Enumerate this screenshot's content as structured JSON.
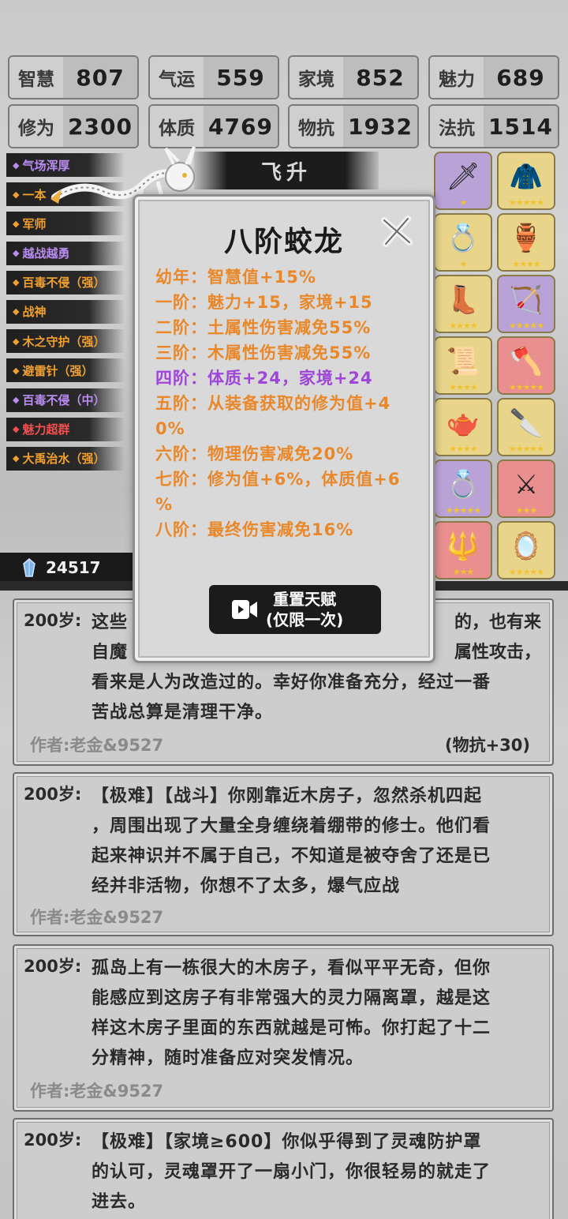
{
  "stats": [
    {
      "label": "智慧",
      "value": "807"
    },
    {
      "label": "气运",
      "value": "559"
    },
    {
      "label": "家境",
      "value": "852"
    },
    {
      "label": "魅力",
      "value": "689"
    },
    {
      "label": "修为",
      "value": "2300"
    },
    {
      "label": "体质",
      "value": "4769"
    },
    {
      "label": "物抗",
      "value": "1932"
    },
    {
      "label": "法抗",
      "value": "1514"
    }
  ],
  "talents": [
    {
      "label": "气场浑厚",
      "color": "#b98cf0"
    },
    {
      "label": "一本",
      "color": "#f0a030"
    },
    {
      "label": "军师",
      "color": "#f0a030"
    },
    {
      "label": "越战越勇",
      "color": "#b98cf0"
    },
    {
      "label": "百毒不侵（强）",
      "color": "#f0a030"
    },
    {
      "label": "战神",
      "color": "#f0a030"
    },
    {
      "label": "木之守护（强）",
      "color": "#f0a030"
    },
    {
      "label": "避雷针（强）",
      "color": "#f0a030"
    },
    {
      "label": "百毒不侵（中）",
      "color": "#b98cf0"
    },
    {
      "label": "魅力超群",
      "color": "#f05050"
    },
    {
      "label": "大禹治水（强）",
      "color": "#f0a030"
    }
  ],
  "banner": "飞升",
  "wealth": "24517",
  "equipment": [
    {
      "icon": "sword-icon",
      "glyph": "🗡",
      "bg": "#b9a3d6",
      "stars": "★"
    },
    {
      "icon": "armor-icon",
      "glyph": "🧥",
      "bg": "#e8d58a",
      "stars": "★★★★★"
    },
    {
      "icon": "ring-icon",
      "glyph": "💍",
      "bg": "#e8d58a",
      "stars": "★"
    },
    {
      "icon": "cauldron-icon",
      "glyph": "🏺",
      "bg": "#e8d58a",
      "stars": "★★★★"
    },
    {
      "icon": "boots-icon",
      "glyph": "👢",
      "bg": "#e8d58a",
      "stars": "★★★★"
    },
    {
      "icon": "bow-icon",
      "glyph": "🏹",
      "bg": "#b9a3d6",
      "stars": "★★★★★"
    },
    {
      "icon": "scroll-icon",
      "glyph": "📜",
      "bg": "#e8d58a",
      "stars": "★★★★"
    },
    {
      "icon": "axe-icon",
      "glyph": "🪓",
      "bg": "#e98f8f",
      "stars": "★★★★★"
    },
    {
      "icon": "teapot-icon",
      "glyph": "🫖",
      "bg": "#e8d58a",
      "stars": "★★★★"
    },
    {
      "icon": "dagger-icon",
      "glyph": "🔪",
      "bg": "#e8d58a",
      "stars": "★★★★★"
    },
    {
      "icon": "ring-icon",
      "glyph": "💍",
      "bg": "#b9a3d6",
      "stars": "★★★★★"
    },
    {
      "icon": "sword-icon",
      "glyph": "⚔",
      "bg": "#e98f8f",
      "stars": "★★★"
    },
    {
      "icon": "spear-icon",
      "glyph": "🔱",
      "bg": "#e98f8f",
      "stars": "★★★"
    },
    {
      "icon": "mirror-icon",
      "glyph": "🪞",
      "bg": "#e8d58a",
      "stars": "★★★★★"
    }
  ],
  "modal": {
    "title": "八阶蛟龙",
    "lines": [
      {
        "text": "幼年：智慧值+15%",
        "color": "orange"
      },
      {
        "text": "一阶：魅力+15，家境+15",
        "color": "orange"
      },
      {
        "text": "二阶：土属性伤害减免55%",
        "color": "orange"
      },
      {
        "text": "三阶：木属性伤害减免55%",
        "color": "orange"
      },
      {
        "text": "四阶：体质+24，家境+24",
        "color": "purple"
      },
      {
        "text": "五阶：从装备获取的修为值+4",
        "color": "orange"
      },
      {
        "text": "0%",
        "color": "orange"
      },
      {
        "text": "六阶：物理伤害减免20%",
        "color": "orange"
      },
      {
        "text": "七阶：修为值+6%，体质值+6",
        "color": "orange"
      },
      {
        "text": "%",
        "color": "orange"
      },
      {
        "text": "八阶：最终伤害减免16%",
        "color": "orange"
      }
    ],
    "reset_line1": "重置天赋",
    "reset_line2": "(仅限一次)"
  },
  "events": [
    {
      "age": "200岁:",
      "lines": [
        "这些",
        "自魔",
        "看来是人为改造过的。幸好你准备充分，经过一番",
        "苦战总算是清理干净。"
      ],
      "right_fragments": [
        "的，也有来",
        "属性攻击，"
      ],
      "author": "作者:老金&9527",
      "effect": "(物抗+30)"
    },
    {
      "age": "200岁:",
      "lines": [
        "【极难】【战斗】你刚靠近木房子，忽然杀机四起",
        "，周围出现了大量全身缠绕着绷带的修士。他们看",
        "起来神识并不属于自己，不知道是被夺舍了还是已",
        "经并非活物，你想不了太多，爆气应战"
      ],
      "author": "作者:老金&9527",
      "effect": ""
    },
    {
      "age": "200岁:",
      "lines": [
        "孤岛上有一栋很大的木房子，看似平平无奇，但你",
        "能感应到这房子有非常强大的灵力隔离罩，越是这",
        "样这木房子里面的东西就越是可怖。你打起了十二",
        "分精神，随时准备应对突发情况。"
      ],
      "author": "作者:老金&9527",
      "effect": ""
    },
    {
      "age": "200岁:",
      "lines": [
        "【极难】【家境≥600】你似乎得到了灵魂防护罩",
        "的认可，灵魂罩开了一扇小门，你很轻易的就走了",
        "进去。"
      ],
      "author": "",
      "effect": ""
    }
  ]
}
